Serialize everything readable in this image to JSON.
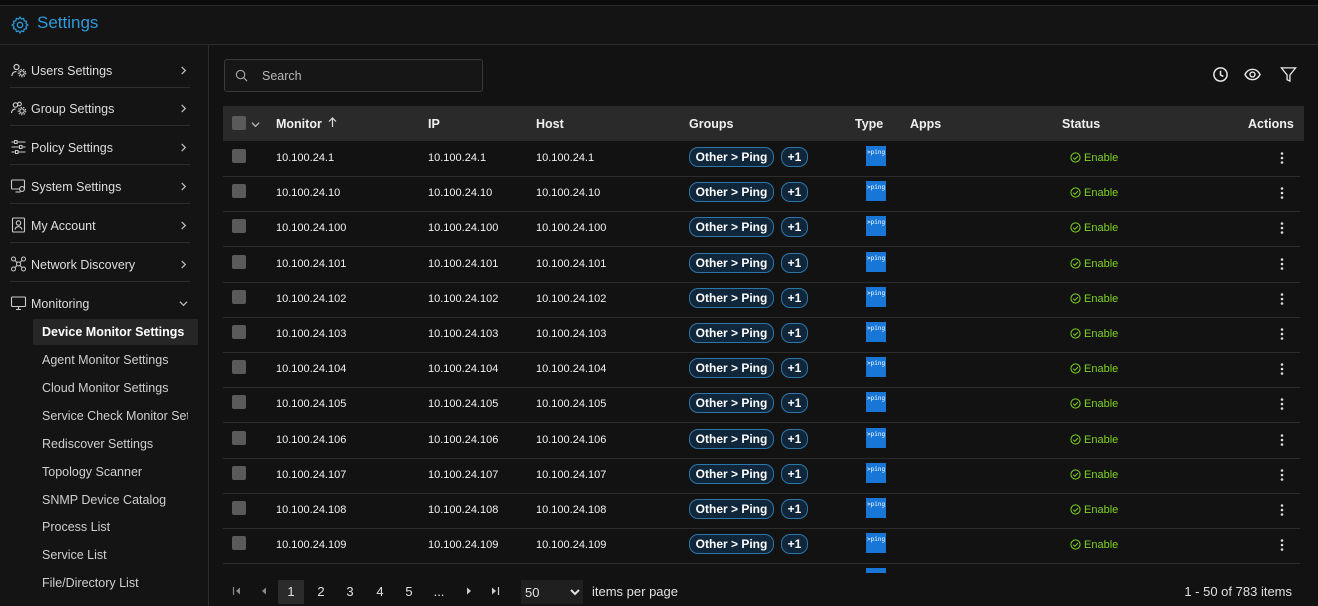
{
  "app": {
    "title": "Settings"
  },
  "sidebar": {
    "items": [
      {
        "label": "Users Settings",
        "icon": "users-gear-icon"
      },
      {
        "label": "Group Settings",
        "icon": "group-gear-icon"
      },
      {
        "label": "Policy Settings",
        "icon": "sliders-icon"
      },
      {
        "label": "System Settings",
        "icon": "system-gear-icon"
      },
      {
        "label": "My Account",
        "icon": "account-icon"
      },
      {
        "label": "Network Discovery",
        "icon": "network-icon"
      },
      {
        "label": "Monitoring",
        "icon": "monitor-icon"
      }
    ],
    "sub_items": [
      "Device Monitor Settings",
      "Agent Monitor Settings",
      "Cloud Monitor Settings",
      "Service Check Monitor Settings",
      "Rediscover Settings",
      "Topology Scanner",
      "SNMP Device Catalog",
      "Process List",
      "Service List",
      "File/Directory List"
    ]
  },
  "search": {
    "placeholder": "Search"
  },
  "table": {
    "headers": {
      "monitor": "Monitor",
      "ip": "IP",
      "host": "Host",
      "groups": "Groups",
      "type": "Type",
      "apps": "Apps",
      "status": "Status",
      "actions": "Actions"
    },
    "sort_icon": "arrow-up-icon",
    "group_label": "Other > Ping",
    "group_extra": "+1",
    "type_badge": ">ping",
    "status_label": "Enable",
    "rows": [
      {
        "monitor": "10.100.24.1",
        "ip": "10.100.24.1",
        "host": "10.100.24.1"
      },
      {
        "monitor": "10.100.24.10",
        "ip": "10.100.24.10",
        "host": "10.100.24.10"
      },
      {
        "monitor": "10.100.24.100",
        "ip": "10.100.24.100",
        "host": "10.100.24.100"
      },
      {
        "monitor": "10.100.24.101",
        "ip": "10.100.24.101",
        "host": "10.100.24.101"
      },
      {
        "monitor": "10.100.24.102",
        "ip": "10.100.24.102",
        "host": "10.100.24.102"
      },
      {
        "monitor": "10.100.24.103",
        "ip": "10.100.24.103",
        "host": "10.100.24.103"
      },
      {
        "monitor": "10.100.24.104",
        "ip": "10.100.24.104",
        "host": "10.100.24.104"
      },
      {
        "monitor": "10.100.24.105",
        "ip": "10.100.24.105",
        "host": "10.100.24.105"
      },
      {
        "monitor": "10.100.24.106",
        "ip": "10.100.24.106",
        "host": "10.100.24.106"
      },
      {
        "monitor": "10.100.24.107",
        "ip": "10.100.24.107",
        "host": "10.100.24.107"
      },
      {
        "monitor": "10.100.24.108",
        "ip": "10.100.24.108",
        "host": "10.100.24.108"
      },
      {
        "monitor": "10.100.24.109",
        "ip": "10.100.24.109",
        "host": "10.100.24.109"
      }
    ]
  },
  "pager": {
    "pages": [
      "1",
      "2",
      "3",
      "4",
      "5",
      "..."
    ],
    "page_size": "50",
    "page_size_options": [
      "50"
    ],
    "items_per_page_label": "items per page",
    "total": "1 - 50 of 783 items"
  },
  "colors": {
    "accent": "#2e9bdc",
    "enable": "#7ed321",
    "ping": "#1877d6",
    "pill_border": "#2d76a8"
  }
}
